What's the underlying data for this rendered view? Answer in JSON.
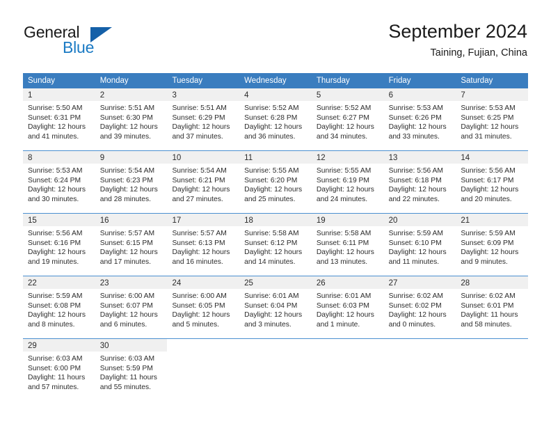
{
  "brand": {
    "name_part1": "General",
    "name_part2": "Blue",
    "accent_color": "#1a7ac4",
    "triangle_color": "#1560a8",
    "triangle_icon": "triangle-icon"
  },
  "header": {
    "month_title": "September 2024",
    "location": "Taining, Fujian, China"
  },
  "calendar": {
    "header_color": "#3a7dbf",
    "date_strip_color": "#f0f0f0",
    "weekdays": [
      "Sunday",
      "Monday",
      "Tuesday",
      "Wednesday",
      "Thursday",
      "Friday",
      "Saturday"
    ],
    "weeks": [
      [
        {
          "date": "1",
          "sunrise": "Sunrise: 5:50 AM",
          "sunset": "Sunset: 6:31 PM",
          "daylight_line1": "Daylight: 12 hours",
          "daylight_line2": "and 41 minutes."
        },
        {
          "date": "2",
          "sunrise": "Sunrise: 5:51 AM",
          "sunset": "Sunset: 6:30 PM",
          "daylight_line1": "Daylight: 12 hours",
          "daylight_line2": "and 39 minutes."
        },
        {
          "date": "3",
          "sunrise": "Sunrise: 5:51 AM",
          "sunset": "Sunset: 6:29 PM",
          "daylight_line1": "Daylight: 12 hours",
          "daylight_line2": "and 37 minutes."
        },
        {
          "date": "4",
          "sunrise": "Sunrise: 5:52 AM",
          "sunset": "Sunset: 6:28 PM",
          "daylight_line1": "Daylight: 12 hours",
          "daylight_line2": "and 36 minutes."
        },
        {
          "date": "5",
          "sunrise": "Sunrise: 5:52 AM",
          "sunset": "Sunset: 6:27 PM",
          "daylight_line1": "Daylight: 12 hours",
          "daylight_line2": "and 34 minutes."
        },
        {
          "date": "6",
          "sunrise": "Sunrise: 5:53 AM",
          "sunset": "Sunset: 6:26 PM",
          "daylight_line1": "Daylight: 12 hours",
          "daylight_line2": "and 33 minutes."
        },
        {
          "date": "7",
          "sunrise": "Sunrise: 5:53 AM",
          "sunset": "Sunset: 6:25 PM",
          "daylight_line1": "Daylight: 12 hours",
          "daylight_line2": "and 31 minutes."
        }
      ],
      [
        {
          "date": "8",
          "sunrise": "Sunrise: 5:53 AM",
          "sunset": "Sunset: 6:24 PM",
          "daylight_line1": "Daylight: 12 hours",
          "daylight_line2": "and 30 minutes."
        },
        {
          "date": "9",
          "sunrise": "Sunrise: 5:54 AM",
          "sunset": "Sunset: 6:23 PM",
          "daylight_line1": "Daylight: 12 hours",
          "daylight_line2": "and 28 minutes."
        },
        {
          "date": "10",
          "sunrise": "Sunrise: 5:54 AM",
          "sunset": "Sunset: 6:21 PM",
          "daylight_line1": "Daylight: 12 hours",
          "daylight_line2": "and 27 minutes."
        },
        {
          "date": "11",
          "sunrise": "Sunrise: 5:55 AM",
          "sunset": "Sunset: 6:20 PM",
          "daylight_line1": "Daylight: 12 hours",
          "daylight_line2": "and 25 minutes."
        },
        {
          "date": "12",
          "sunrise": "Sunrise: 5:55 AM",
          "sunset": "Sunset: 6:19 PM",
          "daylight_line1": "Daylight: 12 hours",
          "daylight_line2": "and 24 minutes."
        },
        {
          "date": "13",
          "sunrise": "Sunrise: 5:56 AM",
          "sunset": "Sunset: 6:18 PM",
          "daylight_line1": "Daylight: 12 hours",
          "daylight_line2": "and 22 minutes."
        },
        {
          "date": "14",
          "sunrise": "Sunrise: 5:56 AM",
          "sunset": "Sunset: 6:17 PM",
          "daylight_line1": "Daylight: 12 hours",
          "daylight_line2": "and 20 minutes."
        }
      ],
      [
        {
          "date": "15",
          "sunrise": "Sunrise: 5:56 AM",
          "sunset": "Sunset: 6:16 PM",
          "daylight_line1": "Daylight: 12 hours",
          "daylight_line2": "and 19 minutes."
        },
        {
          "date": "16",
          "sunrise": "Sunrise: 5:57 AM",
          "sunset": "Sunset: 6:15 PM",
          "daylight_line1": "Daylight: 12 hours",
          "daylight_line2": "and 17 minutes."
        },
        {
          "date": "17",
          "sunrise": "Sunrise: 5:57 AM",
          "sunset": "Sunset: 6:13 PM",
          "daylight_line1": "Daylight: 12 hours",
          "daylight_line2": "and 16 minutes."
        },
        {
          "date": "18",
          "sunrise": "Sunrise: 5:58 AM",
          "sunset": "Sunset: 6:12 PM",
          "daylight_line1": "Daylight: 12 hours",
          "daylight_line2": "and 14 minutes."
        },
        {
          "date": "19",
          "sunrise": "Sunrise: 5:58 AM",
          "sunset": "Sunset: 6:11 PM",
          "daylight_line1": "Daylight: 12 hours",
          "daylight_line2": "and 13 minutes."
        },
        {
          "date": "20",
          "sunrise": "Sunrise: 5:59 AM",
          "sunset": "Sunset: 6:10 PM",
          "daylight_line1": "Daylight: 12 hours",
          "daylight_line2": "and 11 minutes."
        },
        {
          "date": "21",
          "sunrise": "Sunrise: 5:59 AM",
          "sunset": "Sunset: 6:09 PM",
          "daylight_line1": "Daylight: 12 hours",
          "daylight_line2": "and 9 minutes."
        }
      ],
      [
        {
          "date": "22",
          "sunrise": "Sunrise: 5:59 AM",
          "sunset": "Sunset: 6:08 PM",
          "daylight_line1": "Daylight: 12 hours",
          "daylight_line2": "and 8 minutes."
        },
        {
          "date": "23",
          "sunrise": "Sunrise: 6:00 AM",
          "sunset": "Sunset: 6:07 PM",
          "daylight_line1": "Daylight: 12 hours",
          "daylight_line2": "and 6 minutes."
        },
        {
          "date": "24",
          "sunrise": "Sunrise: 6:00 AM",
          "sunset": "Sunset: 6:05 PM",
          "daylight_line1": "Daylight: 12 hours",
          "daylight_line2": "and 5 minutes."
        },
        {
          "date": "25",
          "sunrise": "Sunrise: 6:01 AM",
          "sunset": "Sunset: 6:04 PM",
          "daylight_line1": "Daylight: 12 hours",
          "daylight_line2": "and 3 minutes."
        },
        {
          "date": "26",
          "sunrise": "Sunrise: 6:01 AM",
          "sunset": "Sunset: 6:03 PM",
          "daylight_line1": "Daylight: 12 hours",
          "daylight_line2": "and 1 minute."
        },
        {
          "date": "27",
          "sunrise": "Sunrise: 6:02 AM",
          "sunset": "Sunset: 6:02 PM",
          "daylight_line1": "Daylight: 12 hours",
          "daylight_line2": "and 0 minutes."
        },
        {
          "date": "28",
          "sunrise": "Sunrise: 6:02 AM",
          "sunset": "Sunset: 6:01 PM",
          "daylight_line1": "Daylight: 11 hours",
          "daylight_line2": "and 58 minutes."
        }
      ],
      [
        {
          "date": "29",
          "sunrise": "Sunrise: 6:03 AM",
          "sunset": "Sunset: 6:00 PM",
          "daylight_line1": "Daylight: 11 hours",
          "daylight_line2": "and 57 minutes."
        },
        {
          "date": "30",
          "sunrise": "Sunrise: 6:03 AM",
          "sunset": "Sunset: 5:59 PM",
          "daylight_line1": "Daylight: 11 hours",
          "daylight_line2": "and 55 minutes."
        },
        {
          "date": "",
          "sunrise": "",
          "sunset": "",
          "daylight_line1": "",
          "daylight_line2": ""
        },
        {
          "date": "",
          "sunrise": "",
          "sunset": "",
          "daylight_line1": "",
          "daylight_line2": ""
        },
        {
          "date": "",
          "sunrise": "",
          "sunset": "",
          "daylight_line1": "",
          "daylight_line2": ""
        },
        {
          "date": "",
          "sunrise": "",
          "sunset": "",
          "daylight_line1": "",
          "daylight_line2": ""
        },
        {
          "date": "",
          "sunrise": "",
          "sunset": "",
          "daylight_line1": "",
          "daylight_line2": ""
        }
      ]
    ]
  }
}
